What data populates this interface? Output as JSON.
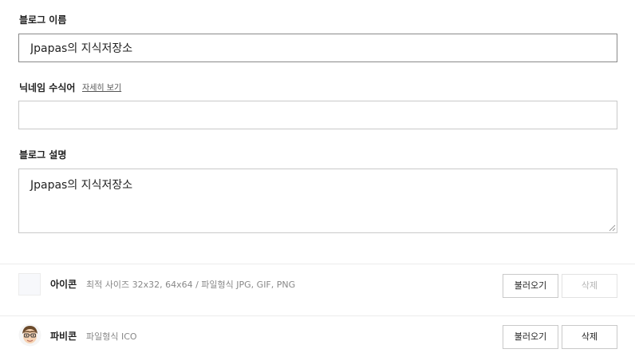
{
  "blog_name": {
    "label": "블로그 이름",
    "value": "Jpapas의 지식저장소"
  },
  "nickname_keyword": {
    "label": "닉네임 수식어",
    "help_link": "자세히 보기",
    "value": ""
  },
  "blog_description": {
    "label": "블로그 설명",
    "value": "Jpapas의 지식저장소"
  },
  "icon_row": {
    "title": "아이콘",
    "description": "최적 사이즈 32x32, 64x64 / 파일형식 JPG, GIF, PNG",
    "load_label": "불러오기",
    "delete_label": "삭제",
    "delete_disabled": true
  },
  "favicon_row": {
    "title": "파비콘",
    "description": "파일형식 ICO",
    "load_label": "불러오기",
    "delete_label": "삭제",
    "delete_disabled": false
  },
  "colors": {
    "border": "#c9c9c9",
    "disabled_text": "#b5b5b5",
    "muted_text": "#888888"
  }
}
